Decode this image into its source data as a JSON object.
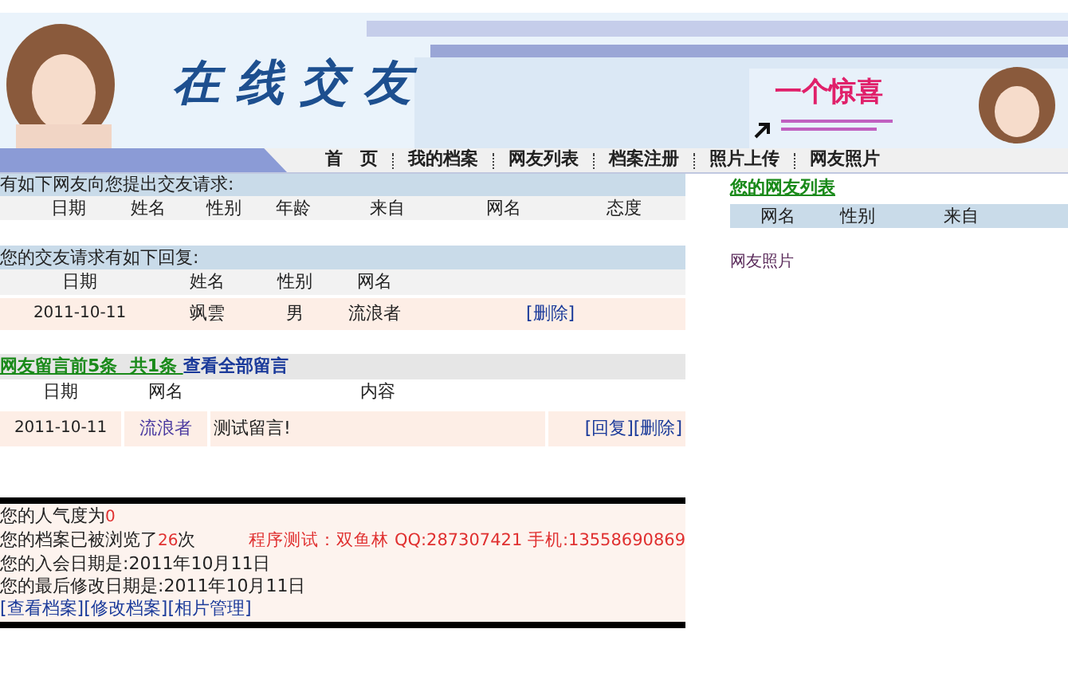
{
  "banner": {
    "title": "在线交友",
    "promo": "一个惊喜"
  },
  "nav": [
    {
      "label": "首　页"
    },
    {
      "label": "我的档案"
    },
    {
      "label": "网友列表"
    },
    {
      "label": "档案注册"
    },
    {
      "label": "照片上传"
    },
    {
      "label": "网友照片"
    }
  ],
  "requests": {
    "heading": "有如下网友向您提出交友请求:",
    "columns": [
      "日期",
      "姓名",
      "性别",
      "年龄",
      "来自",
      "网名",
      "态度"
    ]
  },
  "replies": {
    "heading": "您的交友请求有如下回复:",
    "columns": [
      "日期",
      "姓名",
      "性别",
      "网名"
    ],
    "rows": [
      {
        "date": "2011-10-11",
        "name": "飒雲",
        "gender": "男",
        "nickname": "流浪者",
        "action": "[删除]"
      }
    ]
  },
  "messages": {
    "heading": "网友留言前5条  共1条 ",
    "view_all": "查看全部留言",
    "columns": [
      "日期",
      "网名",
      "内容"
    ],
    "rows": [
      {
        "date": "2011-10-11",
        "nickname": "流浪者",
        "content": "测试留言!",
        "reply": "[回复]",
        "delete": "[删除]"
      }
    ]
  },
  "stats": {
    "popularity_label": "您的人气度为",
    "popularity": "0",
    "views_label": "您的档案已被浏览了",
    "views": "26",
    "views_unit": "次",
    "credit": "程序测试：双鱼林  QQ:287307421  手机:13558690869",
    "joined": "您的入会日期是:2011年10月11日",
    "modified": "您的最后修改日期是:2011年10月11日",
    "links": [
      "[查看档案]",
      "[修改档案]",
      "[相片管理]"
    ]
  },
  "friends": {
    "heading": "您的网友列表",
    "columns": [
      "网名",
      "性别",
      "来自"
    ],
    "photos_label": "网友照片"
  }
}
